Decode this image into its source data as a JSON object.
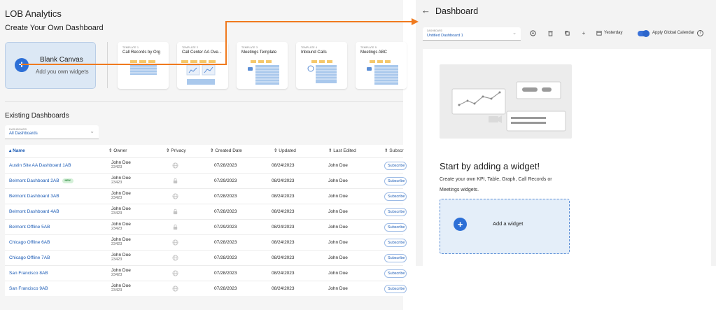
{
  "left": {
    "app_title": "LOB Analytics",
    "section_title": "Create Your Own Dashboard",
    "blank_canvas": {
      "title": "Blank Canvas",
      "subtitle": "Add you own widgets"
    },
    "templates": [
      {
        "kicker": "TEMPLATE 1",
        "name": "Call Records by Org"
      },
      {
        "kicker": "TEMPLATE 2",
        "name": "Call Center AA Ove..."
      },
      {
        "kicker": "TEMPLATE 3",
        "name": "Meetings Template"
      },
      {
        "kicker": "TEMPLATE 4",
        "name": "Inbound Calls"
      },
      {
        "kicker": "TEMPLATE 5",
        "name": "Meetings ABC"
      }
    ],
    "existing_title": "Existing Dashboards",
    "filter": {
      "kicker": "DASHBOARD",
      "value": "All Dashboards"
    },
    "table": {
      "columns": [
        "Name",
        "Owner",
        "Privacy",
        "Created Date",
        "Updated",
        "Last Edited",
        "Subscr"
      ],
      "rows": [
        {
          "name": "Austin Site AA Dashboard  1AB",
          "badge": "",
          "owner": "John Doe",
          "owner_id": "23423",
          "privacy": "public",
          "created": "07/28/2023",
          "updated": "08/24/2023",
          "last_edited": "John Doe",
          "subscribe": "Subscribe"
        },
        {
          "name": "Belmont Dashboard  2AB",
          "badge": "NEW",
          "owner": "John Doe",
          "owner_id": "23423",
          "privacy": "private",
          "created": "07/29/2023",
          "updated": "08/24/2023",
          "last_edited": "John Doe",
          "subscribe": "Subscribe"
        },
        {
          "name": "Belmont Dashboard  3AB",
          "badge": "",
          "owner": "John Doe",
          "owner_id": "23423",
          "privacy": "public",
          "created": "07/28/2023",
          "updated": "08/24/2023",
          "last_edited": "John Doe",
          "subscribe": "Subscribe"
        },
        {
          "name": "Belmont Dashboard  4AB",
          "badge": "",
          "owner": "John Doe",
          "owner_id": "23423",
          "privacy": "private",
          "created": "07/28/2023",
          "updated": "08/24/2023",
          "last_edited": "John Doe",
          "subscribe": "Subscribe"
        },
        {
          "name": "Belmont Offline  5AB",
          "badge": "",
          "owner": "John Doe",
          "owner_id": "23423",
          "privacy": "private",
          "created": "07/29/2023",
          "updated": "08/24/2023",
          "last_edited": "John Doe",
          "subscribe": "Subscribe"
        },
        {
          "name": "Chicago Offline  6AB",
          "badge": "",
          "owner": "John Doe",
          "owner_id": "23423",
          "privacy": "public",
          "created": "07/28/2023",
          "updated": "08/24/2023",
          "last_edited": "John Doe",
          "subscribe": "Subscribe"
        },
        {
          "name": "Chicago Offline  7AB",
          "badge": "",
          "owner": "John Doe",
          "owner_id": "23423",
          "privacy": "public",
          "created": "07/28/2023",
          "updated": "08/24/2023",
          "last_edited": "John Doe",
          "subscribe": "Subscribe"
        },
        {
          "name": "San Francisco  8AB",
          "badge": "",
          "owner": "John Doe",
          "owner_id": "23423",
          "privacy": "public",
          "created": "07/28/2023",
          "updated": "08/24/2023",
          "last_edited": "John Doe",
          "subscribe": "Subscribe"
        },
        {
          "name": "San Francisco  9AB",
          "badge": "",
          "owner": "John Doe",
          "owner_id": "23423",
          "privacy": "public",
          "created": "07/28/2023",
          "updated": "08/24/2023",
          "last_edited": "John Doe",
          "subscribe": "Subscribe"
        }
      ]
    }
  },
  "right": {
    "back_icon": "arrow-left-icon",
    "title": "Dashboard",
    "selector": {
      "kicker": "DASHBOARD",
      "value": "Untitled Dashboard 1"
    },
    "toolbar_icons": [
      "palette-icon",
      "trash-icon",
      "copy-icon",
      "plus-icon"
    ],
    "date_label": "Yesterday",
    "toggle_on": true,
    "apply_label": "Apply Global Calendar",
    "empty_title": "Start by adding a widget!",
    "empty_desc": "Create your own KPI, Table, Graph, Call Records or Meetings widgets.",
    "add_widget_label": "Add a widget"
  },
  "colors": {
    "accent": "#2d6fd6",
    "link": "#1b5bb5",
    "arrow": "#f07a1e",
    "badge_bg": "#d4f0d8",
    "badge_text": "#2a8a3c"
  }
}
